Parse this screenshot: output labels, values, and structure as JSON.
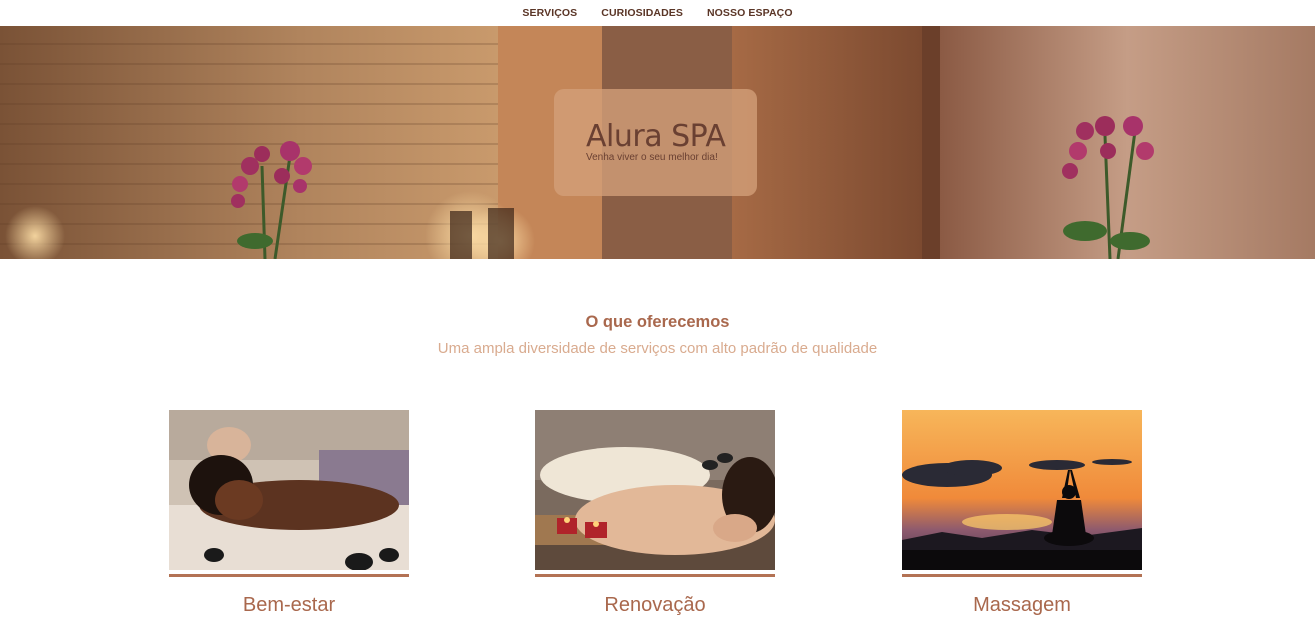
{
  "nav": {
    "items": [
      {
        "label": "SERVIÇOS"
      },
      {
        "label": "CURIOSIDADES"
      },
      {
        "label": "NOSSO ESPAÇO"
      }
    ]
  },
  "hero": {
    "title": "Alura SPA",
    "subtitle": "Venha viver o seu melhor dia!"
  },
  "services": {
    "title": "O que oferecemos",
    "subtitle": "Uma ampla diversidade de serviços com alto padrão de qualidade",
    "cards": [
      {
        "label": "Bem-estar"
      },
      {
        "label": "Renovação"
      },
      {
        "label": "Massagem"
      }
    ]
  },
  "colors": {
    "accent": "#a9684d",
    "accent_light": "#d9ab8f",
    "nav_text": "#5a3526",
    "card_bar": "#b37254"
  }
}
